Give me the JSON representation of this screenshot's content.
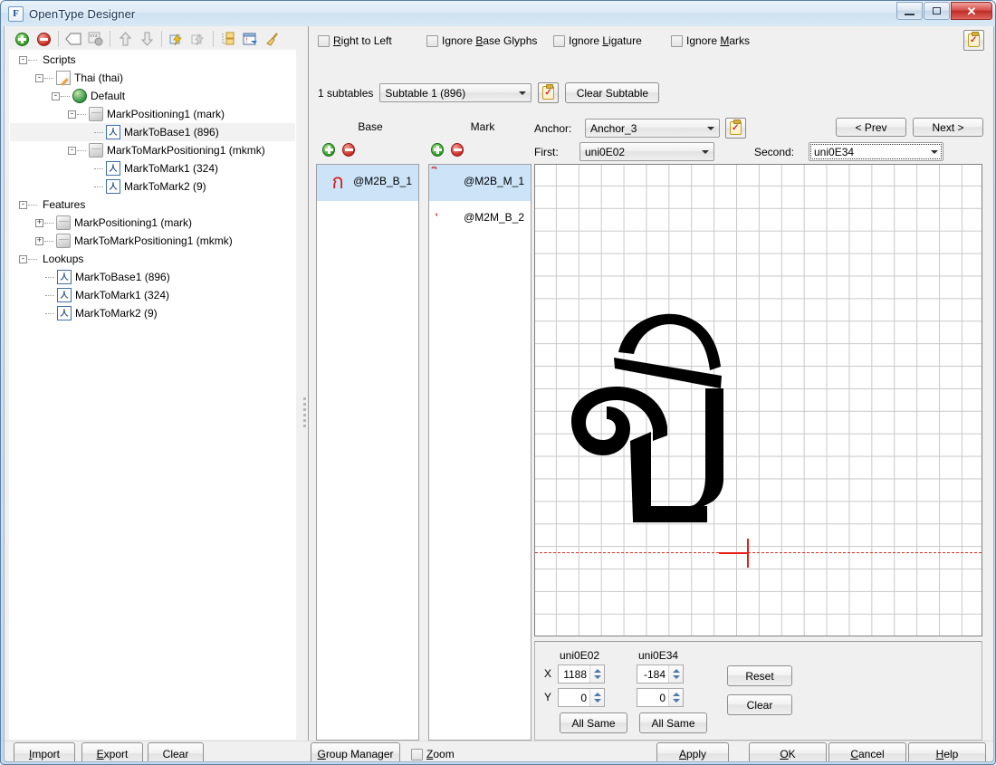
{
  "window": {
    "title": "OpenType Designer",
    "app_icon": "opentype-designer-icon",
    "minimize_label": "Minimize",
    "maximize_label": "Maximize",
    "close_label": "Close"
  },
  "tree_toolbar": {
    "buttons": [
      {
        "name": "add-icon",
        "label": "Add"
      },
      {
        "name": "remove-icon",
        "label": "Remove"
      },
      {
        "name": "rename-tag-icon",
        "label": "Rename"
      },
      {
        "name": "xyz-properties-icon",
        "label": "Properties"
      },
      {
        "name": "move-up-icon",
        "label": "Move Up"
      },
      {
        "name": "move-down-icon",
        "label": "Move Down"
      },
      {
        "name": "compile-lightning-icon",
        "label": "Compile"
      },
      {
        "name": "compile-all-icon",
        "label": "Compile All"
      },
      {
        "name": "expand-tree-icon",
        "label": "Expand"
      },
      {
        "name": "edit-lookup-icon",
        "label": "Edit Lookup"
      },
      {
        "name": "broom-clean-icon",
        "label": "Clean"
      }
    ]
  },
  "tree": {
    "nodes": [
      {
        "label": "Scripts",
        "indent": 0,
        "expander": "-",
        "icon": "none",
        "selected": false
      },
      {
        "label": "Thai (thai)",
        "indent": 1,
        "expander": "-",
        "icon": "pencil",
        "selected": false
      },
      {
        "label": "Default",
        "indent": 2,
        "expander": "-",
        "icon": "globe",
        "selected": false
      },
      {
        "label": "MarkPositioning1 (mark)",
        "indent": 3,
        "expander": "-",
        "icon": "cube",
        "selected": false
      },
      {
        "label": "MarkToBase1 (896)",
        "indent": 4,
        "expander": "",
        "icon": "glyph",
        "selected": true
      },
      {
        "label": "MarkToMarkPositioning1 (mkmk)",
        "indent": 3,
        "expander": "-",
        "icon": "cube",
        "selected": false
      },
      {
        "label": "MarkToMark1 (324)",
        "indent": 4,
        "expander": "",
        "icon": "glyph",
        "selected": false
      },
      {
        "label": "MarkToMark2 (9)",
        "indent": 4,
        "expander": "",
        "icon": "glyph",
        "selected": false
      },
      {
        "label": "Features",
        "indent": 0,
        "expander": "-",
        "icon": "none",
        "selected": false
      },
      {
        "label": "MarkPositioning1 (mark)",
        "indent": 1,
        "expander": "+",
        "icon": "cube",
        "selected": false
      },
      {
        "label": "MarkToMarkPositioning1 (mkmk)",
        "indent": 1,
        "expander": "+",
        "icon": "cube",
        "selected": false
      },
      {
        "label": "Lookups",
        "indent": 0,
        "expander": "-",
        "icon": "none",
        "selected": false
      },
      {
        "label": "MarkToBase1 (896)",
        "indent": 1,
        "expander": "",
        "icon": "glyph",
        "selected": false
      },
      {
        "label": "MarkToMark1 (324)",
        "indent": 1,
        "expander": "",
        "icon": "glyph",
        "selected": false
      },
      {
        "label": "MarkToMark2 (9)",
        "indent": 1,
        "expander": "",
        "icon": "glyph",
        "selected": false
      }
    ]
  },
  "options": {
    "right_to_left": {
      "label": "Right to Left",
      "mnemonic": "R",
      "checked": false
    },
    "ignore_base_glyphs": {
      "label": "Ignore Base Glyphs",
      "mnemonic": "B",
      "checked": false
    },
    "ignore_ligature": {
      "label": "Ignore Ligature",
      "mnemonic": "L",
      "checked": false
    },
    "ignore_marks": {
      "label": "Ignore Marks",
      "mnemonic": "M",
      "checked": false
    }
  },
  "subtable": {
    "count_label": "1 subtables",
    "selected": "Subtable 1 (896)",
    "clear_label": "Clear Subtable",
    "clipboard_icon": "clipboard-check-icon"
  },
  "lists": {
    "base_header": "Base",
    "mark_header": "Mark",
    "add_icon": "add-icon",
    "remove_icon": "remove-icon",
    "base_items": [
      {
        "glyph": "ก",
        "name": "@M2B_B_1",
        "selected": true
      }
    ],
    "mark_items": [
      {
        "glyph": "ิ",
        "name": "@M2B_M_1",
        "selected": true
      },
      {
        "glyph": "ุ",
        "name": "@M2M_B_2",
        "selected": false
      }
    ]
  },
  "anchor": {
    "anchor_label": "Anchor:",
    "anchor_value": "Anchor_3",
    "first_label": "First:",
    "first_value": "uni0E02",
    "second_label": "Second:",
    "second_value": "uni0E34",
    "prev_label": "< Prev",
    "next_label": "Next >",
    "clipboard_icon": "clipboard-check-icon"
  },
  "canvas": {
    "base_glyph": "uni0E02",
    "mark_glyph": "uni0E34",
    "baseline_color": "#e02b20",
    "crosshair_color": "#e81c12",
    "grid_color": "#c9c9c9"
  },
  "coords": {
    "first_name": "uni0E02",
    "second_name": "uni0E34",
    "x_label": "X",
    "y_label": "Y",
    "first_x": "1188",
    "first_y": "0",
    "second_x": "-184",
    "second_y": "0",
    "all_same_label": "All Same",
    "reset_label": "Reset",
    "clear_label": "Clear"
  },
  "footer": {
    "import_label": "Import",
    "import_mnemonic": "I",
    "export_label": "Export",
    "export_mnemonic": "E",
    "clear_label": "Clear",
    "group_manager_label": "Group Manager",
    "group_manager_mnemonic": "G",
    "zoom_label": "Zoom",
    "zoom_mnemonic": "Z",
    "zoom_checked": false,
    "apply_label": "Apply",
    "apply_mnemonic": "A",
    "ok_label": "OK",
    "ok_mnemonic": "O",
    "cancel_label": "Cancel",
    "cancel_mnemonic": "C",
    "help_label": "Help",
    "help_mnemonic": "H"
  }
}
